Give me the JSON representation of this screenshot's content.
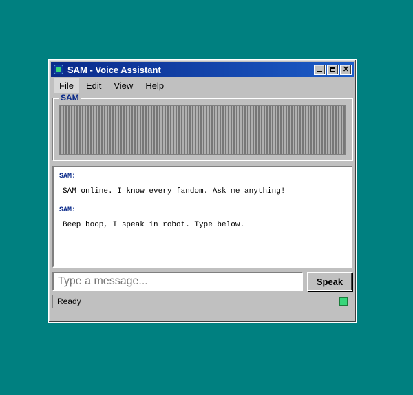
{
  "window": {
    "title": "SAM - Voice Assistant"
  },
  "menu": [
    {
      "label": "File"
    },
    {
      "label": "Edit"
    },
    {
      "label": "View"
    },
    {
      "label": "Help"
    }
  ],
  "visualizer": {
    "label": "SAM"
  },
  "chat": {
    "messages": [
      {
        "speaker": "SAM:",
        "text": "SAM online. I know every fandom. Ask me anything!"
      },
      {
        "speaker": "SAM:",
        "text": "Beep boop, I speak in robot. Type below."
      }
    ]
  },
  "input": {
    "placeholder": "Type a message...",
    "value": ""
  },
  "speak_button": {
    "label": "Speak"
  },
  "status": {
    "text": "Ready",
    "indicator_color": "#37d67a"
  },
  "icons": {
    "app": "app-icon",
    "minimize": "minimize-icon",
    "maximize": "maximize-icon",
    "close": "close-icon"
  },
  "colors": {
    "desktop": "#008080",
    "titlebar": "#0a2a8a",
    "accent": "#0a2a8a"
  }
}
